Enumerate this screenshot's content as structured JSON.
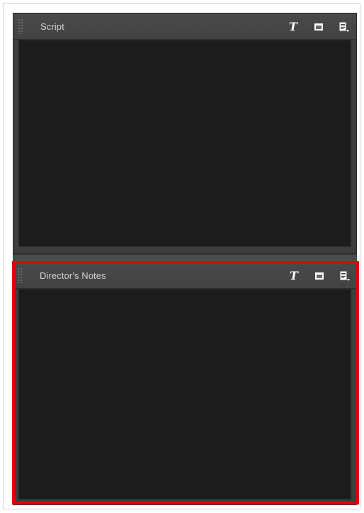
{
  "panels": {
    "script": {
      "title": "Script",
      "tools": {
        "text_icon": "T",
        "text_icon_name": "text-format-icon",
        "window_icon_name": "window-icon",
        "menu_icon_name": "document-menu-icon"
      }
    },
    "notes": {
      "title": "Director's Notes",
      "tools": {
        "text_icon": "T",
        "text_icon_name": "text-format-icon",
        "window_icon_name": "window-icon",
        "menu_icon_name": "document-menu-icon"
      }
    }
  },
  "colors": {
    "panel_background": "#3e3e3e",
    "body_background": "#1c1c1c",
    "title_text": "#d2d2d2",
    "highlight": "#e30000"
  }
}
